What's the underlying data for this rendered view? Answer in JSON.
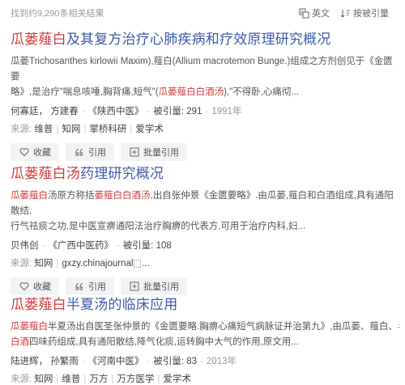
{
  "topbar": {
    "found_text": "找到约9,290条相关结果",
    "lang_label": "英文",
    "sort_label": "按被引量"
  },
  "results": [
    {
      "title_hl": "瓜蒌薤白",
      "title_rest": "及其复方治疗心肺疾病和疗效原理研究概况",
      "abstract_line1": "瓜蒌Trichosanthes kirlowii Maxim),薤白(Allium macrotemon Bunge.)组成之方剂创见于《金匮要",
      "abstract_line2_pre": "略》,是治疗\"喘息咳唾,胸背痛,短气\"(",
      "abstract_line2_hl": "瓜蒌薤白白酒汤",
      "abstract_line2_post": "),\"不得卧,心痛彻...",
      "authors": "何寡廷， 方建春",
      "journal": "《陕西中医》",
      "cited": "被引量: 291",
      "year": "1991年",
      "source_label": "来源:",
      "sources": [
        "维普",
        "知网",
        "掌桥科研",
        "爱学术"
      ],
      "btn_collect": "收藏",
      "btn_cite": "引用",
      "btn_batch": "批量引用"
    },
    {
      "title_hl": "瓜蒌薤白汤",
      "title_rest": "药理研究概况",
      "abstract_line1_pre": "",
      "abstract_line1_hl1": "瓜蒌薤白",
      "abstract_line1_mid": "汤原方称括",
      "abstract_line1_hl2": "蒌薤白白酒汤",
      "abstract_line1_post": ",出自张仲景《金匮要略》.由瓜蒌,薤白和白酒组成,具有通阳散结,",
      "abstract_line2": "行气祛痰之功,是中医宣痹通阳法治疗胸痹的代表方,可用于治疗内科,妇...",
      "authors": "贝伟创",
      "journal": "《广西中医药》",
      "cited": "被引量: 108",
      "source_label": "来源:",
      "sources": [
        "知网",
        "gxzy.chinajournal⬚..."
      ],
      "btn_collect": "收藏",
      "btn_cite": "引用",
      "btn_batch": "批量引用"
    },
    {
      "title_hl": "瓜蒌薤白",
      "title_rest": "半夏汤的临床应用",
      "abstract_line1_hl": "瓜蒌薤白",
      "abstract_line1_post": "半夏汤出自医圣张仲景的《金匮要略.胸痹心痛短气病脉证并治第九》,由瓜蒌、薤白、半夏、",
      "abstract_line2_hl": "白酒",
      "abstract_line2_post": "四味药组成,具有通阳散结,降气化痰,运转胸中大气的作用,原文用...",
      "authors": "陆进辉， 孙繁雨",
      "journal": "《河南中医》",
      "cited": "被引量: 83",
      "year": "2013年",
      "source_label": "来源:",
      "sources": [
        "知网",
        "维普",
        "万方",
        "万方医学",
        "爱学术"
      ]
    }
  ],
  "colors": {
    "title": "#3d5ba8",
    "highlight": "#d1393c"
  }
}
